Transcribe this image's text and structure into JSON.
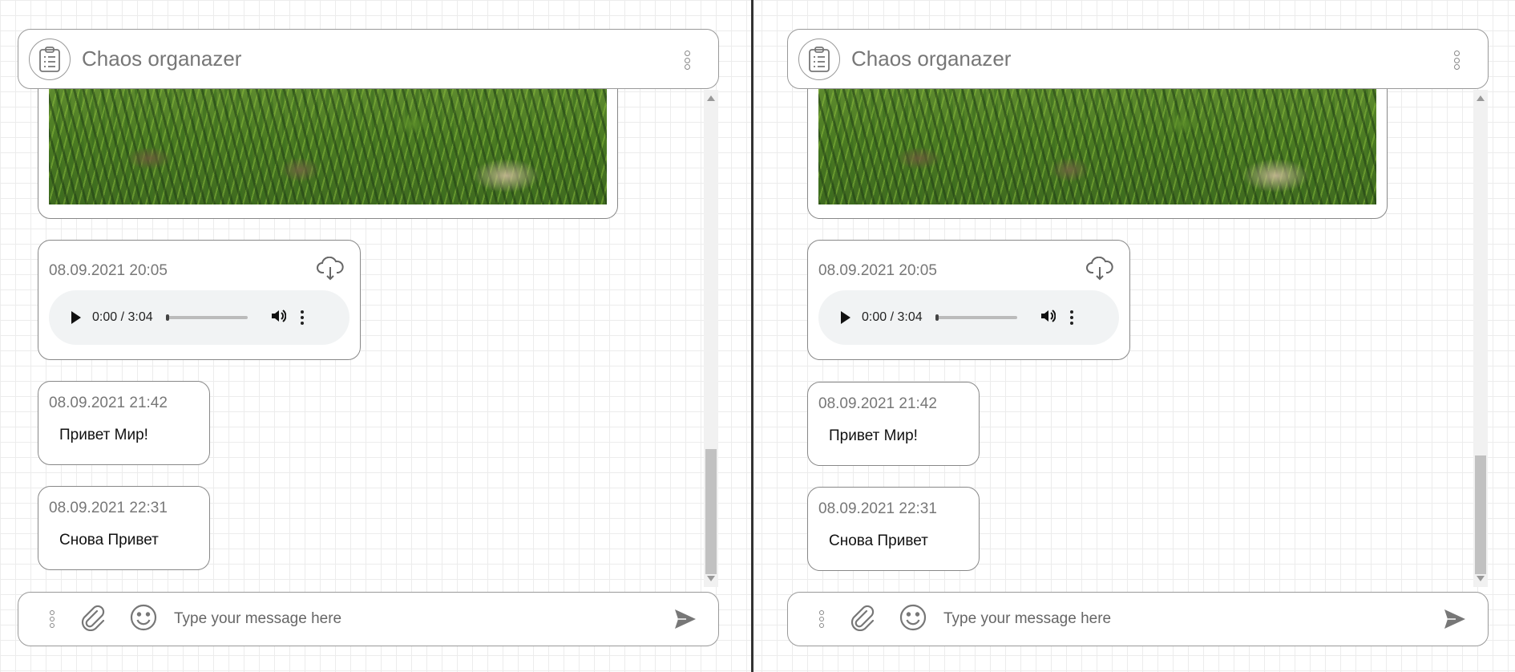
{
  "panes": [
    {
      "header": {
        "title": "Chaos organazer"
      },
      "messages": [
        {
          "type": "image"
        },
        {
          "type": "audio",
          "date": "08.09.2021 20:05",
          "time": "0:00 / 3:04"
        },
        {
          "type": "text",
          "date": "08.09.2021 21:42",
          "text": "Привет Мир!"
        },
        {
          "type": "text",
          "date": "08.09.2021 22:31",
          "text": "Снова Привет"
        }
      ],
      "composer": {
        "placeholder": "Type your message here"
      }
    },
    {
      "header": {
        "title": "Chaos organazer"
      },
      "messages": [
        {
          "type": "image"
        },
        {
          "type": "audio",
          "date": "08.09.2021 20:05",
          "time": "0:00 / 3:04"
        },
        {
          "type": "text",
          "date": "08.09.2021 21:42",
          "text": "Привет Мир!"
        },
        {
          "type": "text",
          "date": "08.09.2021 22:31",
          "text": "Снова Привет"
        }
      ],
      "composer": {
        "placeholder": "Type your message here"
      }
    }
  ],
  "icons": {
    "logo": "clipboard-list-icon",
    "menu": "more-vertical-icon",
    "download": "cloud-download-icon",
    "attach": "paperclip-icon",
    "emoji": "smile-icon",
    "send": "send-icon",
    "play": "play-icon",
    "volume": "volume-icon"
  },
  "colors": {
    "border": "#999999",
    "muted_text": "#777777",
    "player_bg": "#f1f3f4"
  }
}
